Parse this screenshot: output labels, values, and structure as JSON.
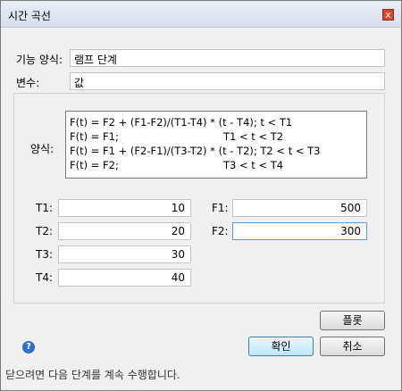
{
  "window": {
    "title": "시간 곡선",
    "close_glyph": "x"
  },
  "form": {
    "function_label": "기능 양식:",
    "function_value": "램프 단계",
    "variable_label": "변수:",
    "variable_value": "값"
  },
  "formula": {
    "label": "양식:",
    "lines": [
      {
        "expr": "F(t) = F2 + (F1-F2)/(T1-T4) * (t - T4); t < T1",
        "cond": ""
      },
      {
        "expr": "F(t) = F1;",
        "cond": "T1 < t < T2"
      },
      {
        "expr": "F(t) = F1 + (F2-F1)/(T3-T2) * (t - T2); T2 < t < T3",
        "cond": ""
      },
      {
        "expr": "F(t) = F2;",
        "cond": "T3 < t < T4"
      }
    ]
  },
  "params": {
    "T1": {
      "label": "T1:",
      "value": "10"
    },
    "T2": {
      "label": "T2:",
      "value": "20"
    },
    "T3": {
      "label": "T3:",
      "value": "30"
    },
    "T4": {
      "label": "T4:",
      "value": "40"
    },
    "F1": {
      "label": "F1:",
      "value": "500"
    },
    "F2": {
      "label": "F2:",
      "value": "300"
    }
  },
  "buttons": {
    "plot": "플롯",
    "ok": "확인",
    "cancel": "취소"
  },
  "help_icon": "question-icon",
  "status_text": "닫으려면 다음 단계를 계속 수행합니다."
}
